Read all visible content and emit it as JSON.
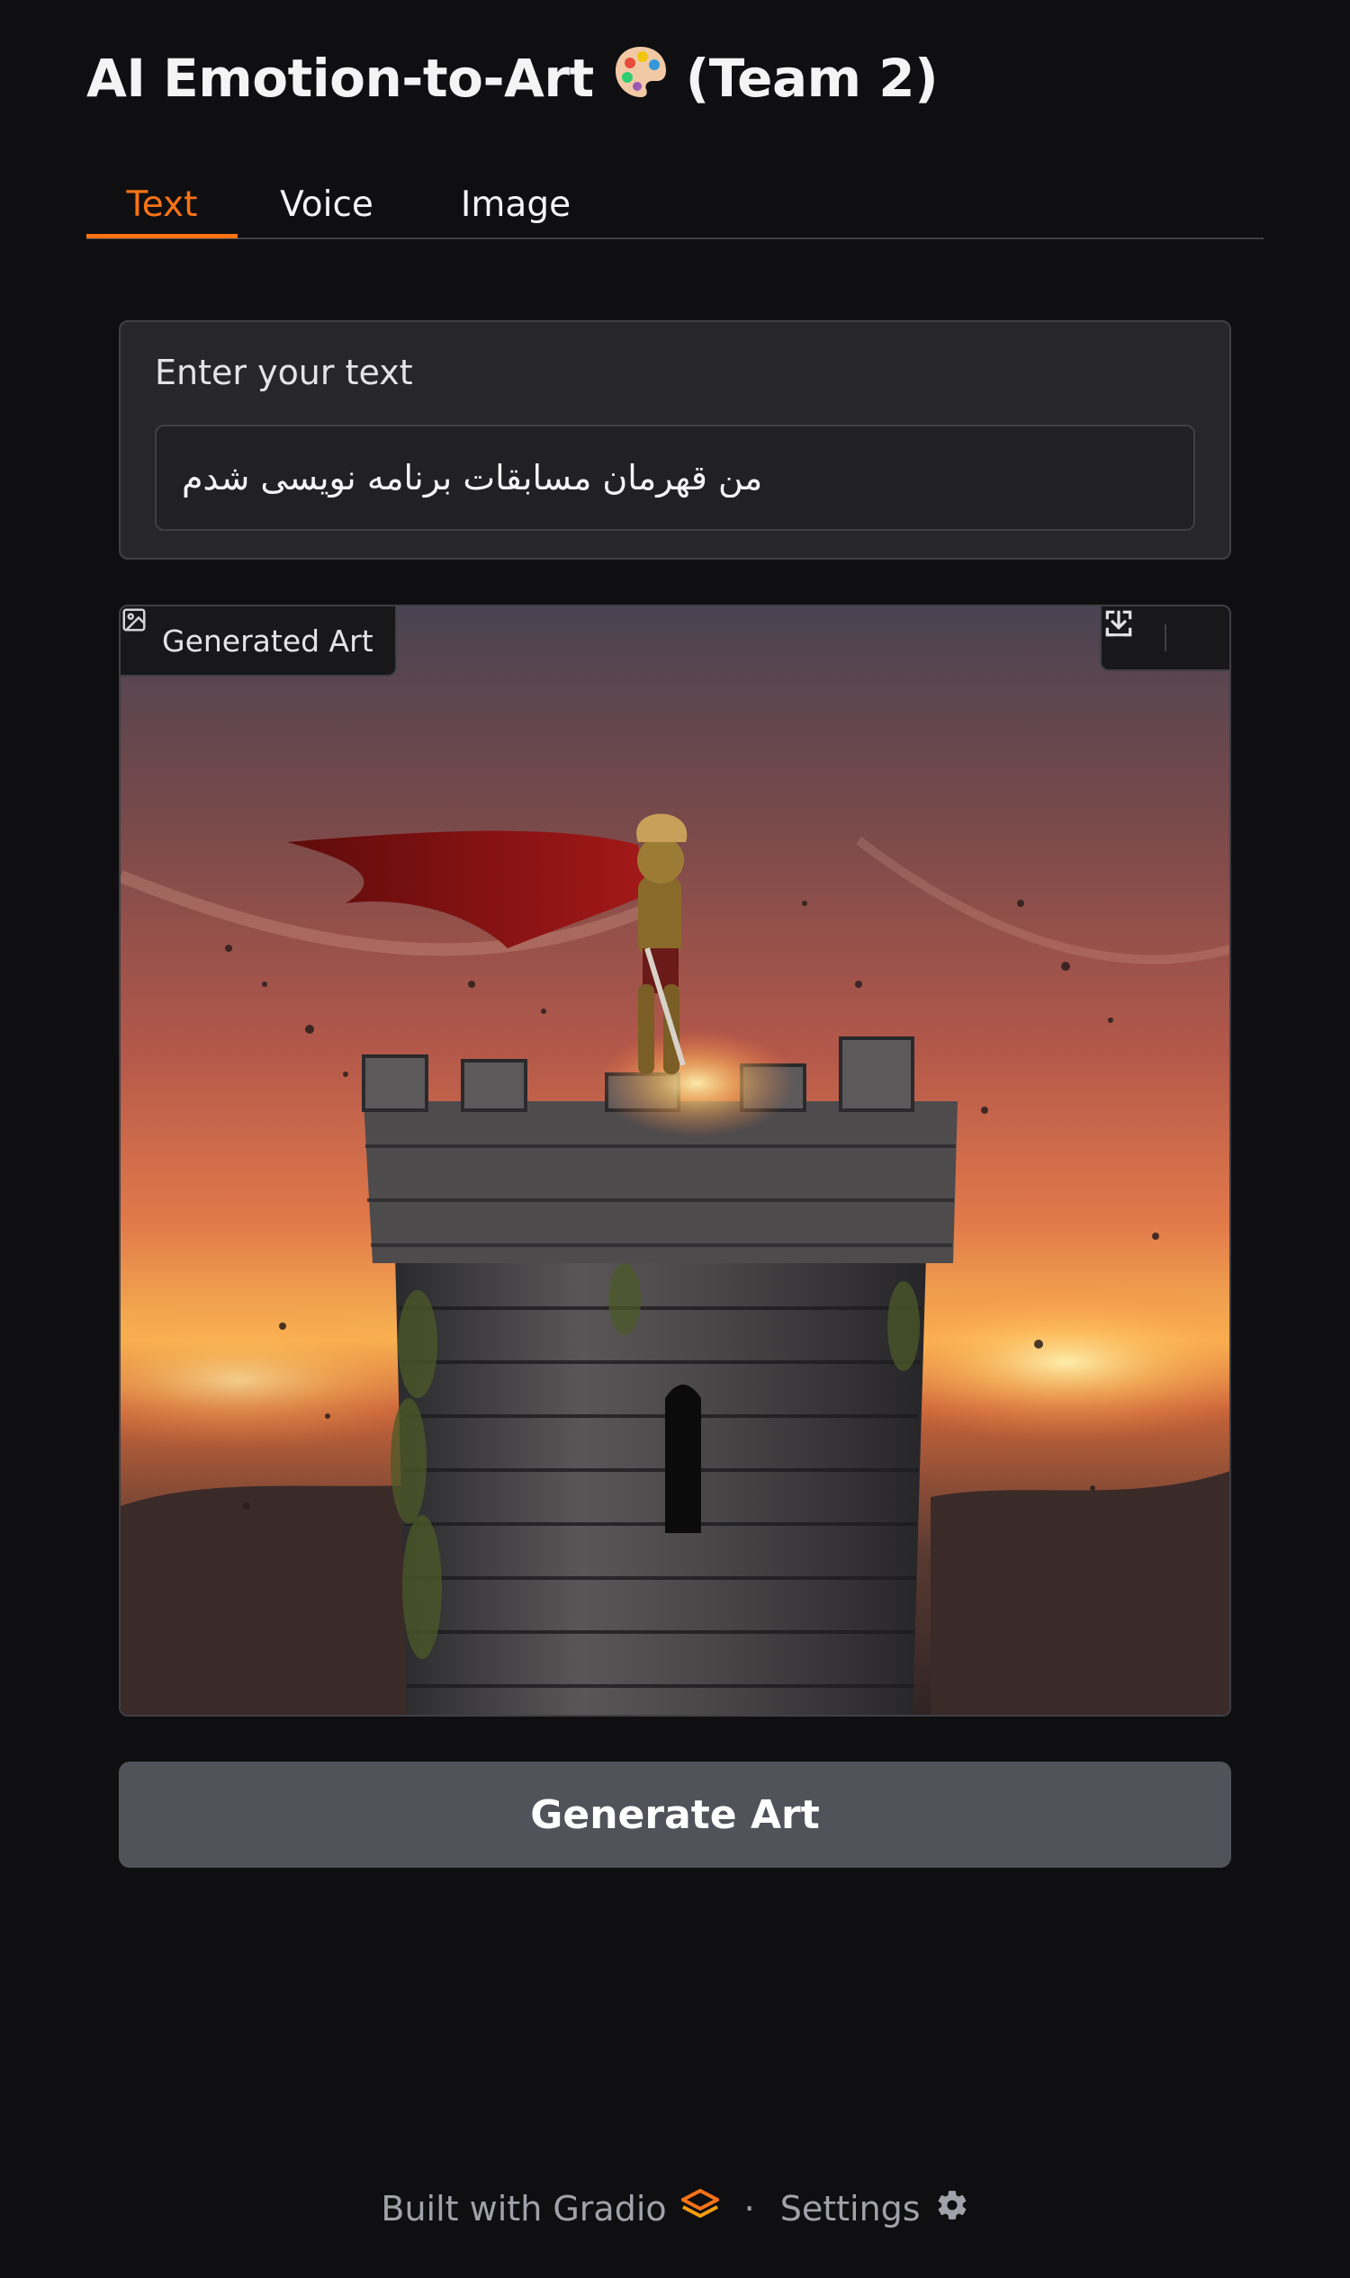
{
  "app": {
    "title": "AI Emotion-to-Art",
    "title_suffix": "(Team 2)",
    "title_icon": "artist-palette-emoji"
  },
  "tabs": [
    {
      "label": "Text",
      "active": true
    },
    {
      "label": "Voice",
      "active": false
    },
    {
      "label": "Image",
      "active": false
    }
  ],
  "text_input": {
    "label": "Enter your text",
    "value": "من قهرمان مسابقات برنامه نویسی شدم"
  },
  "output": {
    "label": "Generated Art",
    "label_icon": "image-icon",
    "image_description": "armored knight with red cape standing atop a stone castle tower at sunset",
    "tools": [
      "fullscreen-icon",
      "download-icon"
    ]
  },
  "actions": {
    "generate_label": "Generate Art"
  },
  "footer": {
    "built_with": "Built with Gradio",
    "separator": "·",
    "settings": "Settings"
  },
  "colors": {
    "background": "#0f0f11",
    "accent": "#f97316",
    "panel": "#27272a",
    "button": "#52525b"
  }
}
